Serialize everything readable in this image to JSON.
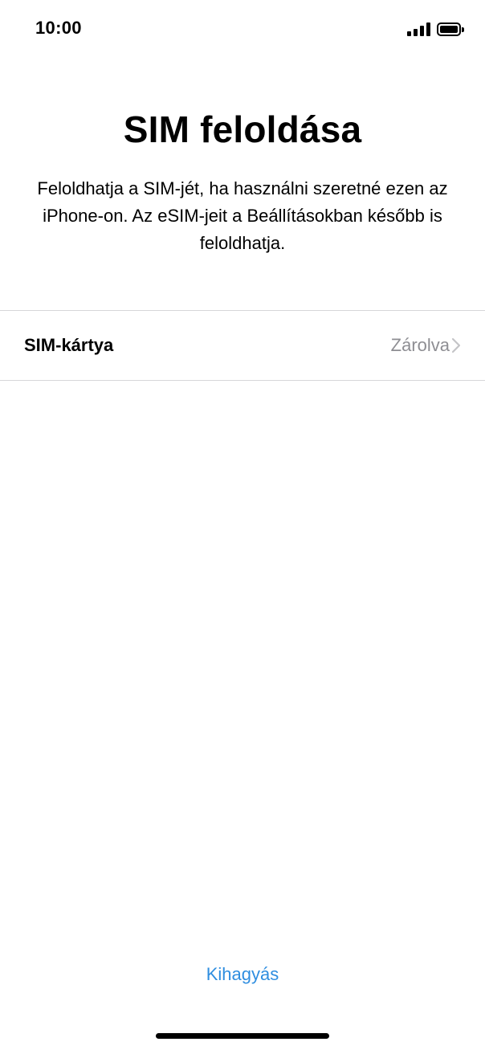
{
  "status_bar": {
    "time": "10:00",
    "icons": [
      "signal-icon",
      "battery-icon"
    ]
  },
  "header": {
    "title": "SIM feloldása",
    "description": "Feloldhatja a SIM-jét, ha használni szeretné ezen az iPhone-on. Az eSIM-jeit a Beállításokban később is feloldhatja."
  },
  "sim_list": {
    "items": [
      {
        "label": "SIM-kártya",
        "value": "Zárolva",
        "icon": "chevron-right-icon"
      }
    ]
  },
  "footer": {
    "skip_label": "Kihagyás"
  },
  "colors": {
    "accent": "#2f8ee0",
    "secondary_text": "#8e8e93",
    "separator": "#d6d6d9"
  }
}
